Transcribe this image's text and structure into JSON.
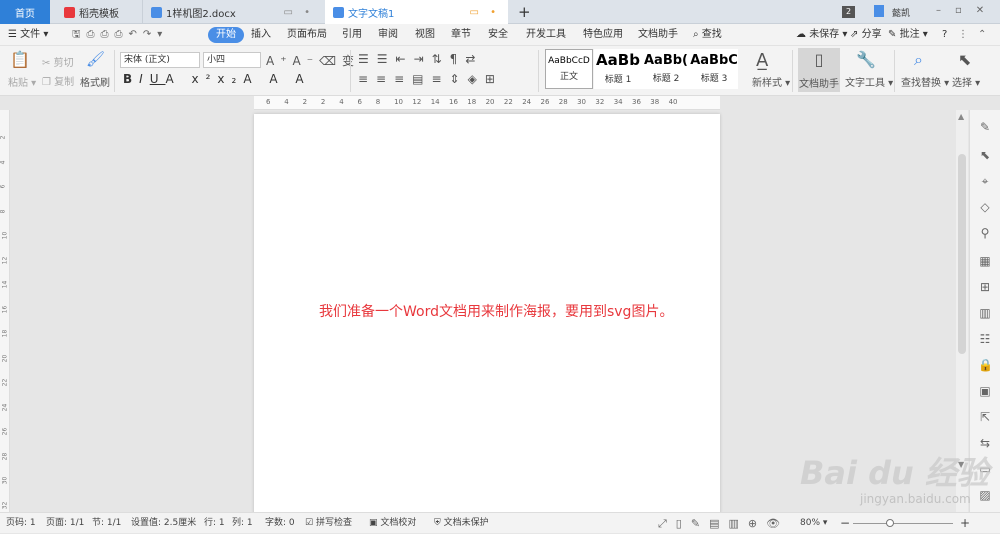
{
  "titlebar": {
    "tabs": [
      {
        "label": "首页"
      },
      {
        "label": "稻壳模板"
      },
      {
        "label": "1样机图2.docx"
      },
      {
        "label": "文字文稿1"
      }
    ],
    "new_tab": "+",
    "badge_count": "2",
    "user": "懿凯"
  },
  "menubar": {
    "file": "文件",
    "tabs": [
      "开始",
      "插入",
      "页面布局",
      "引用",
      "审阅",
      "视图",
      "章节",
      "安全",
      "开发工具",
      "特色应用",
      "文档助手"
    ],
    "search": "查找",
    "unsaved": "未保存",
    "share": "分享",
    "comment": "批注",
    "help": "?"
  },
  "ribbon": {
    "paste": "粘贴",
    "cut": "剪切",
    "copy": "复制",
    "format_painter": "格式刷",
    "font_name": "宋体 (正文)",
    "font_size": "小四",
    "styles": [
      {
        "preview": "AaBbCcD",
        "label": "正文"
      },
      {
        "preview": "AaBb",
        "label": "标题 1"
      },
      {
        "preview": "AaBb(",
        "label": "标题 2"
      },
      {
        "preview": "AaBbC",
        "label": "标题 3"
      }
    ],
    "new_style": "新样式",
    "doc_assistant": "文档助手",
    "text_tools": "文字工具",
    "find_replace": "查找替换",
    "select": "选择"
  },
  "ruler": {
    "ticks": [
      "6",
      "4",
      "2",
      "2",
      "4",
      "6",
      "8",
      "10",
      "12",
      "14",
      "16",
      "18",
      "20",
      "22",
      "24",
      "26",
      "28",
      "30",
      "32",
      "34",
      "36",
      "38",
      "40"
    ]
  },
  "vruler": {
    "ticks": [
      "2",
      "4",
      "6",
      "8",
      "10",
      "12",
      "14",
      "16",
      "18",
      "20",
      "22",
      "24",
      "26",
      "28",
      "30",
      "32"
    ]
  },
  "document": {
    "text": "我们准备一个Word文档用来制作海报，要用到svg图片。",
    "text_color": "#e8383d"
  },
  "statusbar": {
    "page_num": "页码: 1",
    "pages": "页面: 1/1",
    "section": "节: 1/1",
    "setting": "设置值: 2.5厘米",
    "row": "行: 1",
    "col": "列: 1",
    "words": "字数: 0",
    "spell": "拼写检查",
    "proof": "文档校对",
    "protect": "文档未保护",
    "zoom": "80%"
  },
  "watermark": {
    "brand": "Bai du 经验",
    "url": "jingyan.baidu.com"
  }
}
